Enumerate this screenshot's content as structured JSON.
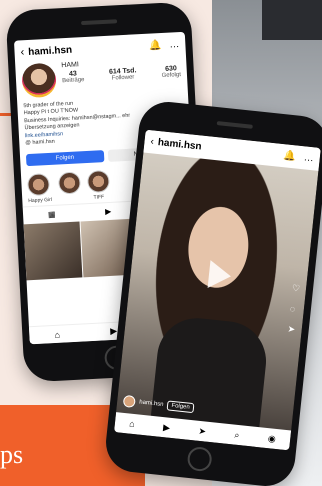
{
  "caption": "ps",
  "phone1": {
    "header": {
      "back": "‹",
      "username": "hami.hsn",
      "bell": "🔔",
      "more": "…"
    },
    "profile": {
      "name": "HAMI",
      "stats": [
        {
          "value": "43",
          "label": "Beiträge"
        },
        {
          "value": "614 Tsd.",
          "label": "Follower"
        },
        {
          "value": "630",
          "label": "Gefolgt"
        }
      ]
    },
    "bio_lines": [
      "5th grader of the run",
      "Happy Pi t OU T'NOW",
      "Business Inquiries: hamihsn@nstagm... ehr",
      "Übersetzung anzeigen",
      "link.ee/hamihsn"
    ],
    "threads_line": "@ hami.hsn",
    "buttons": {
      "follow": "Folgen",
      "message": "Nachricht"
    },
    "highlights": [
      {
        "label": "Happy Girl"
      },
      {
        "label": ""
      },
      {
        "label": "TIFF"
      }
    ],
    "tab_icons": [
      "grid-icon",
      "reels-icon",
      "tagged-icon"
    ],
    "nav_icons": [
      "home-icon",
      "reels-icon",
      "send-icon"
    ]
  },
  "phone2": {
    "header": {
      "back": "‹",
      "username": "hami.hsn",
      "bell": "🔔",
      "more": "…"
    },
    "reel_user": "hami.hsn",
    "reel_follow": "Folgen",
    "nav_icons": [
      "home-icon",
      "reels-icon",
      "send-icon",
      "search-icon",
      "profile-icon"
    ]
  },
  "colors": {
    "accent": "#f0602a",
    "follow_blue": "#2f6cf0"
  }
}
